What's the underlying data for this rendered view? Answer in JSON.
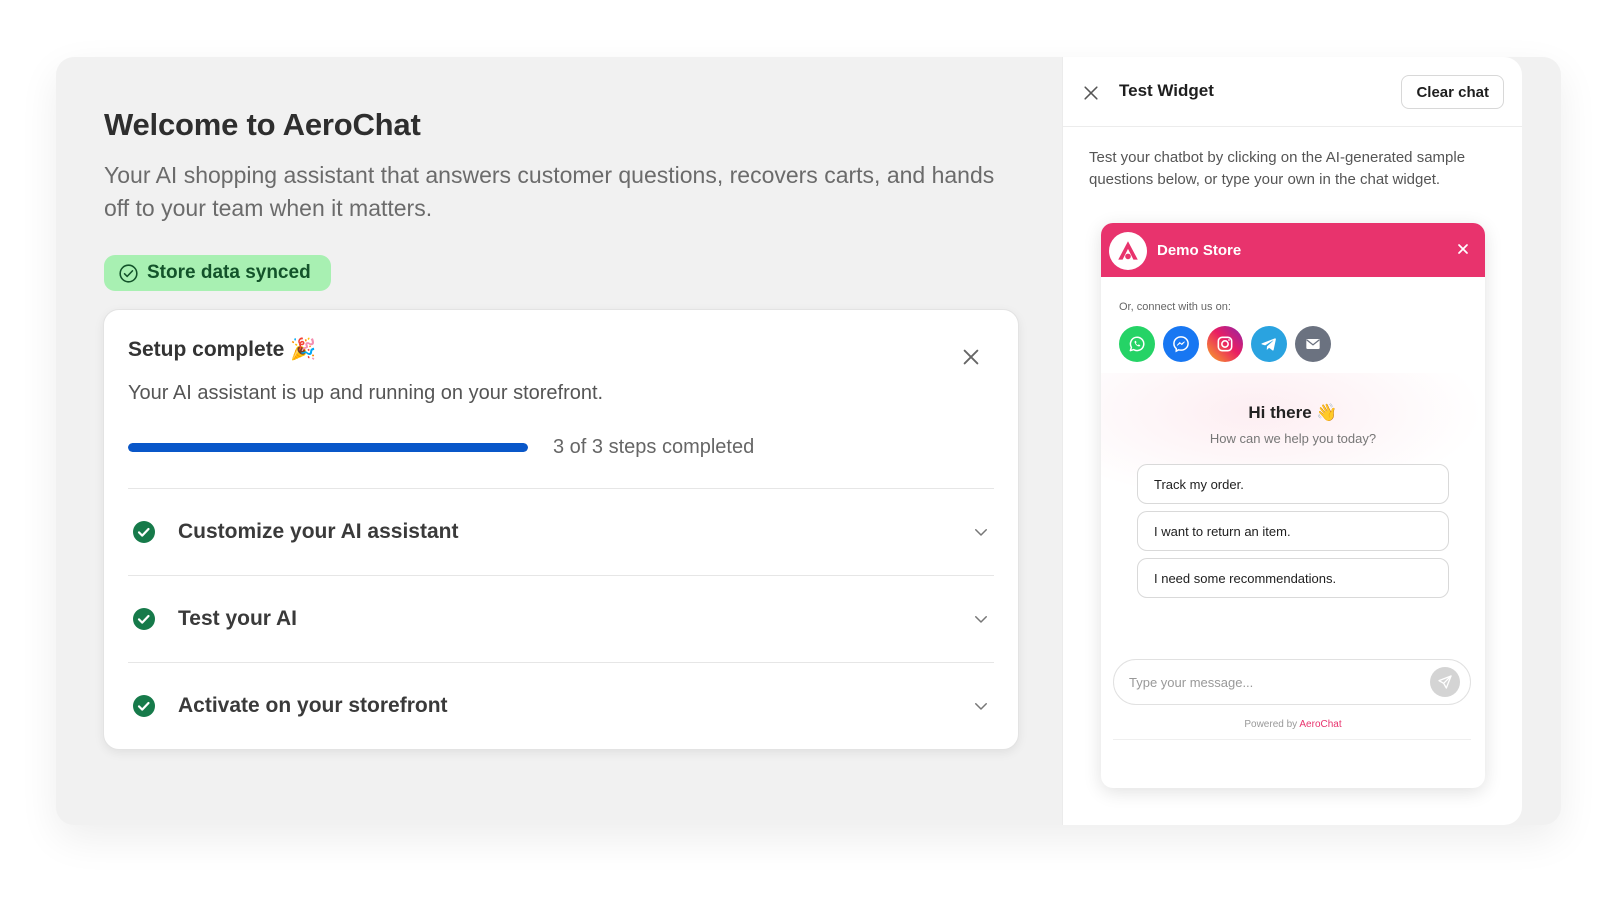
{
  "main": {
    "title": "Welcome to AeroChat",
    "subtitle": "Your AI shopping assistant that answers customer questions, recovers carts, and hands off to your team when it matters.",
    "sync_badge": "Store data synced"
  },
  "setup": {
    "title": "Setup complete 🎉",
    "description": "Your AI assistant is up and running on your storefront.",
    "progress_label": "3 of 3 steps completed",
    "progress_fraction": 1.0,
    "steps": [
      {
        "label": "Customize your AI assistant"
      },
      {
        "label": "Test your AI"
      },
      {
        "label": "Activate on your storefront"
      }
    ]
  },
  "panel": {
    "title": "Test Widget",
    "clear_label": "Clear chat",
    "description": "Test your chatbot by clicking on the AI-generated sample questions below, or type your own in the chat widget."
  },
  "widget": {
    "store_name": "Demo Store",
    "connect_label": "Or, connect with us on:",
    "socials": [
      "whatsapp-icon",
      "messenger-icon",
      "instagram-icon",
      "telegram-icon",
      "email-icon"
    ],
    "greeting": "Hi there 👋",
    "greeting_sub": "How can we help you today?",
    "quick_replies": [
      "Track my order.",
      "I want to return an item.",
      "I need some recommendations."
    ],
    "input_placeholder": "Type your message...",
    "powered_prefix": "Powered by",
    "powered_brand": "AeroChat"
  },
  "colors": {
    "accent_pink": "#e8336d",
    "progress_blue": "#0957c9",
    "success_green": "#167a4a",
    "badge_bg": "#a8f0b2"
  }
}
